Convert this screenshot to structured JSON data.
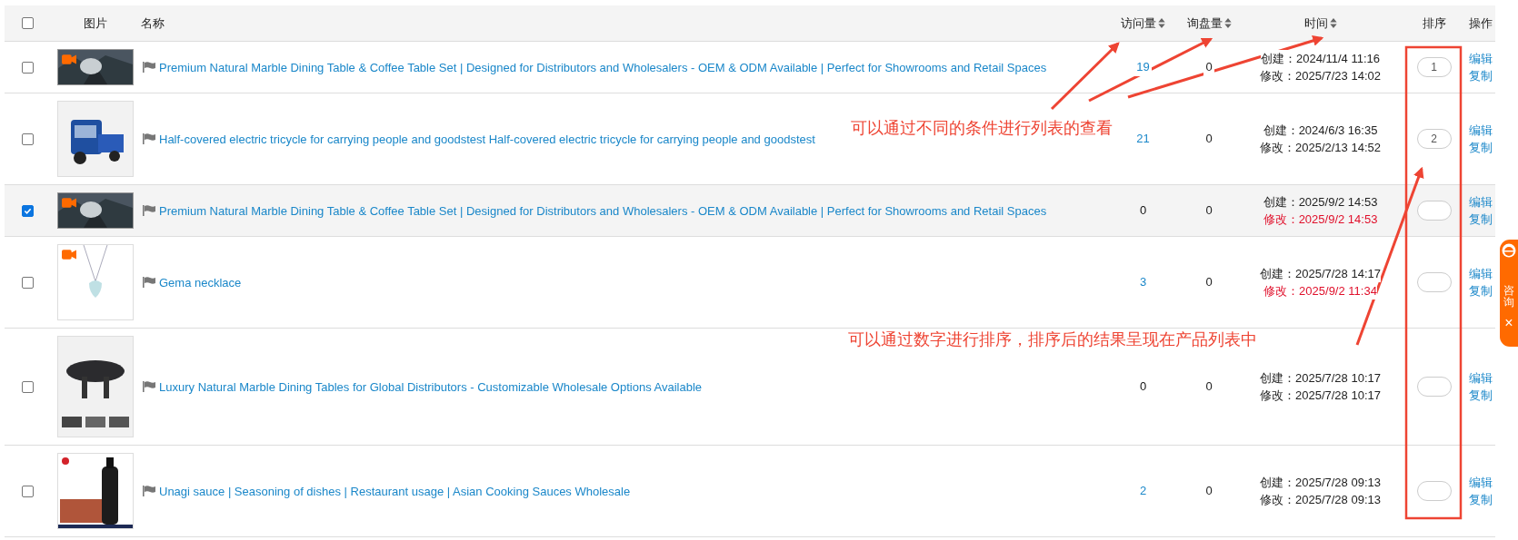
{
  "table": {
    "select_all": {
      "checked": false
    },
    "columns": [
      {
        "label": "图片",
        "sortable": false
      },
      {
        "label": "名称",
        "sortable": false
      },
      {
        "label": "访问量",
        "sortable": true
      },
      {
        "label": "询盘量",
        "sortable": true
      },
      {
        "label": "时间",
        "sortable": true
      },
      {
        "label": "排序",
        "sortable": false
      },
      {
        "label": "操作",
        "sortable": false
      }
    ],
    "rows": [
      {
        "checked": false,
        "image": {
          "kind": "landscape",
          "video": true
        },
        "name": "Premium Natural Marble Dining Table & Coffee Table Set | Designed for Distributors and Wholesalers - OEM & ODM Available | Perfect for Showrooms and Retail Spaces",
        "visits": "19",
        "visits_link": true,
        "inquiries": "0",
        "created": "创建：2024/11/4 11:16",
        "modified": "修改：2025/7/23 14:02",
        "modified_alert": false,
        "sort": "1",
        "actions": [
          "编辑",
          "复制"
        ]
      },
      {
        "checked": false,
        "image": {
          "kind": "vehicle",
          "video": false
        },
        "name": "Half-covered electric tricycle for carrying people and goodstest Half-covered electric tricycle for carrying people and goodstest",
        "visits": "21",
        "visits_link": true,
        "inquiries": "0",
        "created": "创建：2024/6/3 16:35",
        "modified": "修改：2025/2/13 14:52",
        "modified_alert": false,
        "sort": "2",
        "actions": [
          "编辑",
          "复制"
        ]
      },
      {
        "checked": true,
        "image": {
          "kind": "landscape",
          "video": true
        },
        "name": "Premium Natural Marble Dining Table & Coffee Table Set | Designed for Distributors and Wholesalers - OEM & ODM Available | Perfect for Showrooms and Retail Spaces",
        "visits": "0",
        "visits_link": false,
        "inquiries": "0",
        "created": "创建：2025/9/2 14:53",
        "modified": "修改：2025/9/2 14:53",
        "modified_alert": true,
        "actions": [
          "编辑",
          "复制"
        ]
      },
      {
        "checked": false,
        "image": {
          "kind": "necklace",
          "video": true
        },
        "name": "Gema necklace",
        "visits": "3",
        "visits_link": true,
        "inquiries": "0",
        "created": "创建：2025/7/28 14:17",
        "modified": "修改：2025/9/2 11:34",
        "modified_alert": true,
        "actions": [
          "编辑",
          "复制"
        ]
      },
      {
        "checked": false,
        "image": {
          "kind": "table",
          "video": false
        },
        "name": "Luxury Natural Marble Dining Tables for Global Distributors - Customizable Wholesale Options Available",
        "visits": "0",
        "visits_link": false,
        "inquiries": "0",
        "created": "创建：2025/7/28 10:17",
        "modified": "修改：2025/7/28 10:17",
        "modified_alert": false,
        "actions": [
          "编辑",
          "复制"
        ]
      },
      {
        "checked": false,
        "image": {
          "kind": "sauce",
          "video": false
        },
        "name": "Unagi sauce | Seasoning of dishes | Restaurant usage | Asian Cooking Sauces Wholesale",
        "visits": "2",
        "visits_link": true,
        "inquiries": "0",
        "created": "创建：2025/7/28 09:13",
        "modified": "修改：2025/7/28 09:13",
        "modified_alert": false,
        "actions": [
          "编辑",
          "复制"
        ]
      }
    ]
  },
  "annotations": [
    "可以通过不同的条件进行列表的查看",
    "可以通过数字进行排序，排序后的结果呈现在产品列表中"
  ],
  "consult_widget": {
    "label": "咨询",
    "close": "×"
  }
}
